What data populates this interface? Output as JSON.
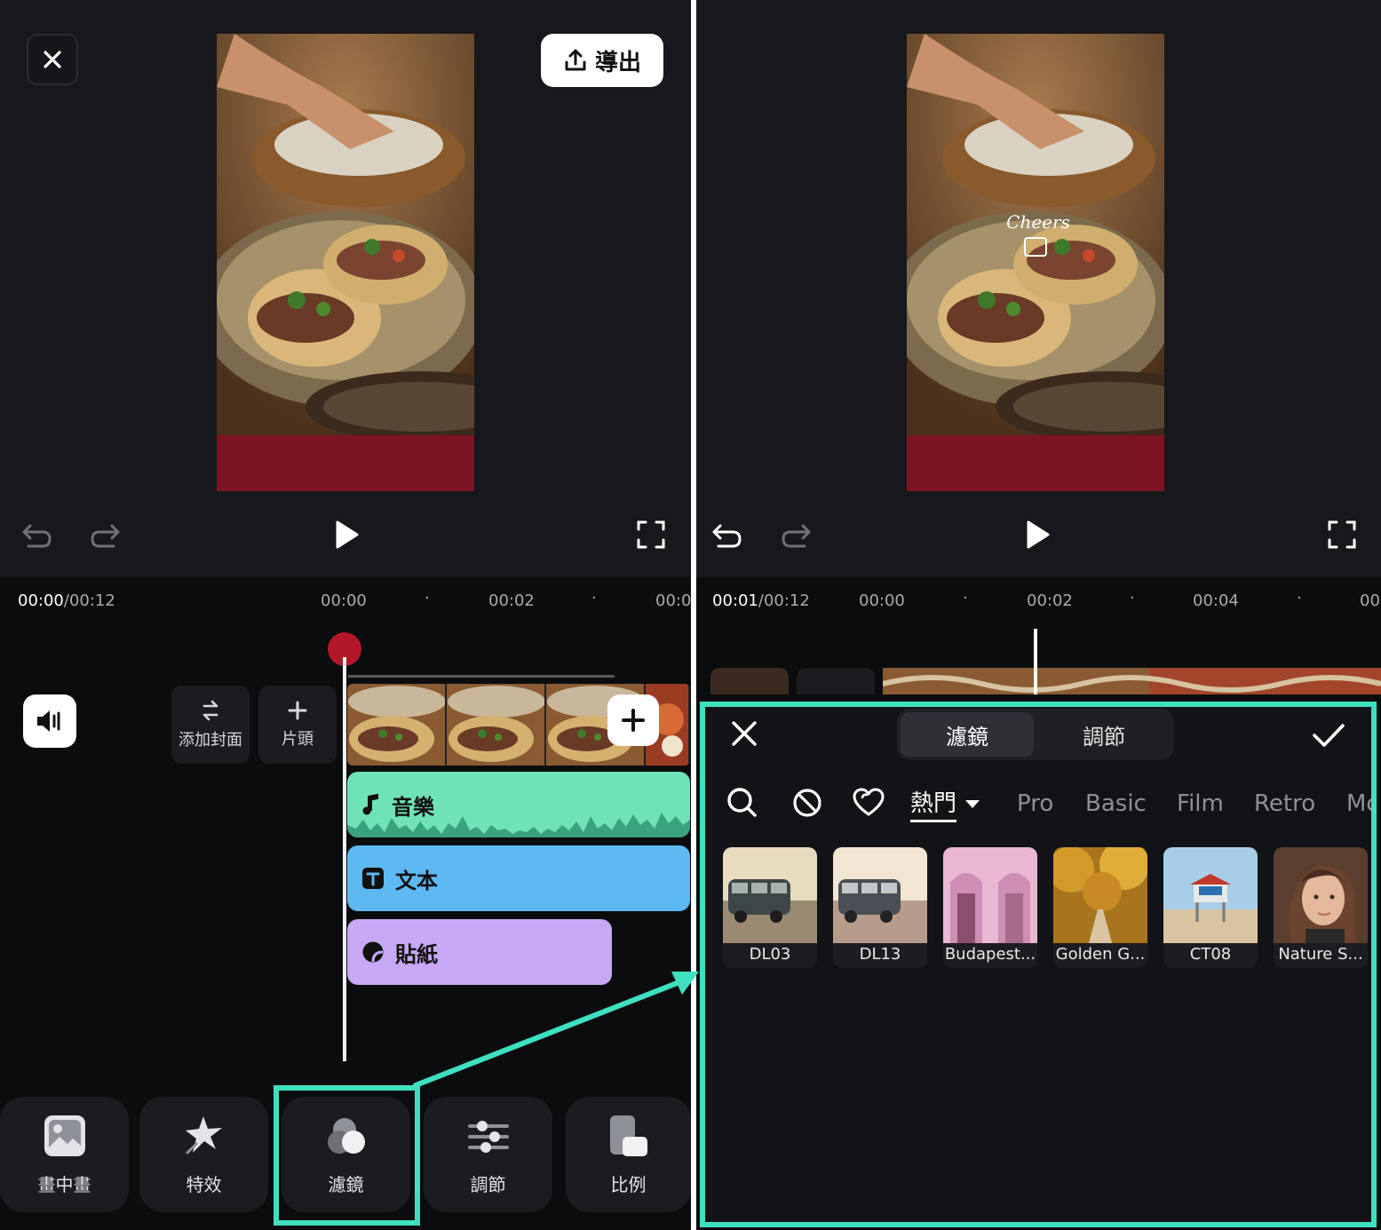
{
  "left_editor": {
    "export_label": "導出",
    "timeline": {
      "current": "00:00",
      "total": "/00:12",
      "ticks": [
        "00:00",
        "00:02",
        "00:0"
      ]
    },
    "side_buttons": {
      "cover_label": "添加封面",
      "intro_label": "片頭"
    },
    "tracks": {
      "music": "音樂",
      "text": "文本",
      "sticker": "貼紙"
    },
    "toolbar": [
      {
        "label": "畫中畫",
        "icon": "picture-in-picture-icon"
      },
      {
        "label": "特效",
        "icon": "effects-star-icon"
      },
      {
        "label": "濾鏡",
        "icon": "filter-icon"
      },
      {
        "label": "調節",
        "icon": "adjust-sliders-icon"
      },
      {
        "label": "比例",
        "icon": "ratio-icon"
      }
    ]
  },
  "right_editor": {
    "timeline": {
      "current": "00:01",
      "total": "/00:12",
      "ticks": [
        "00:00",
        "00:02",
        "00:04",
        "00"
      ]
    },
    "video_overlay_text": "Cheers",
    "filter_panel": {
      "tabs": [
        "濾鏡",
        "調節"
      ],
      "active_tab": "濾鏡",
      "categories": {
        "hot": "熱門",
        "list": [
          "Pro",
          "Basic",
          "Film",
          "Retro",
          "Mo"
        ]
      },
      "filters": [
        "DL03",
        "DL13",
        "Budapest...",
        "Golden G...",
        "CT08",
        "Nature S..."
      ]
    }
  },
  "colors": {
    "accent": "#3fe0c0",
    "music_track": "#6fe3b5",
    "text_track": "#5eb8f2",
    "sticker_track": "#c6a8f5",
    "playhead": "#b3182a",
    "video_band": "#7c1424"
  }
}
